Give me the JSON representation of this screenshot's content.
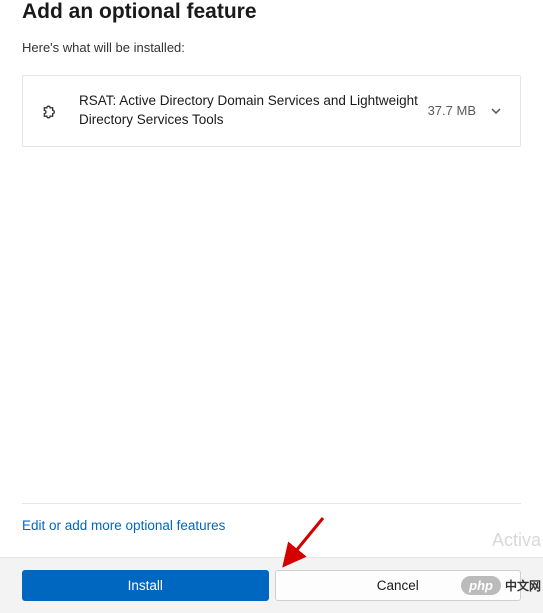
{
  "header": {
    "title": "Add an optional feature",
    "subtitle": "Here's what will be installed:"
  },
  "features": [
    {
      "name": "RSAT: Active Directory Domain Services and Lightweight Directory Services Tools",
      "size": "37.7 MB"
    }
  ],
  "link": {
    "edit_more": "Edit or add more optional features"
  },
  "buttons": {
    "install": "Install",
    "cancel": "Cancel"
  },
  "watermark": {
    "badge": "php",
    "text": "中文网"
  },
  "faint": "Activa"
}
